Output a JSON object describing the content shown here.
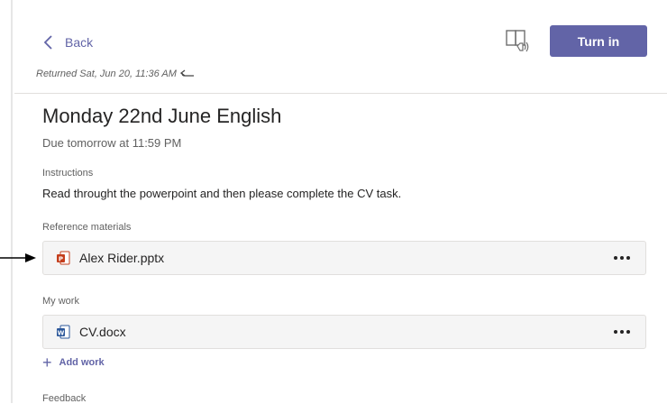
{
  "header": {
    "back_label": "Back",
    "turn_in_label": "Turn in",
    "returned_text": "Returned Sat, Jun 20, 11:36 AM"
  },
  "assignment": {
    "title": "Monday 22nd June English",
    "due": "Due tomorrow at 11:59 PM",
    "instructions_label": "Instructions",
    "instructions_text": "Read throught the powerpoint and then please complete the CV task."
  },
  "reference": {
    "label": "Reference materials",
    "files": [
      {
        "name": "Alex Rider.pptx",
        "icon": "powerpoint-file-icon"
      }
    ]
  },
  "my_work": {
    "label": "My work",
    "files": [
      {
        "name": "CV.docx",
        "icon": "word-file-icon"
      }
    ],
    "add_work_label": "Add work"
  },
  "feedback": {
    "label": "Feedback"
  },
  "colors": {
    "accent": "#6264a7",
    "powerpoint": "#c43e1c",
    "word": "#2b579a"
  }
}
